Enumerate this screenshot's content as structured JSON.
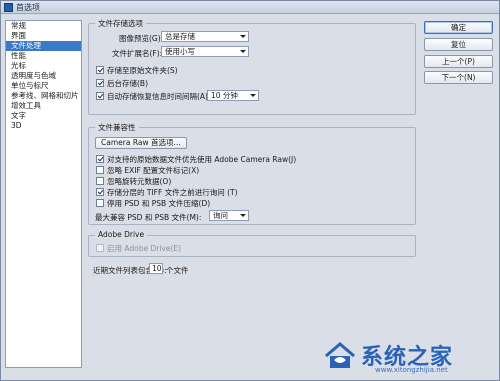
{
  "window": {
    "title": "首选项"
  },
  "sidebar": {
    "items": [
      {
        "label": "常规",
        "selected": false
      },
      {
        "label": "界面",
        "selected": false
      },
      {
        "label": "文件处理",
        "selected": true
      },
      {
        "label": "性能",
        "selected": false
      },
      {
        "label": "光标",
        "selected": false
      },
      {
        "label": "透明度与色域",
        "selected": false
      },
      {
        "label": "单位与标尺",
        "selected": false
      },
      {
        "label": "参考线、网格和切片",
        "selected": false
      },
      {
        "label": "增效工具",
        "selected": false
      },
      {
        "label": "文字",
        "selected": false
      },
      {
        "label": "3D",
        "selected": false
      }
    ]
  },
  "buttons": {
    "ok": "确定",
    "reset": "复位",
    "prev": "上一个(P)",
    "next": "下一个(N)"
  },
  "file_save": {
    "title": "文件存储选项",
    "image_preview_label": "图像预览(G):",
    "image_preview_value": "总是存储",
    "extension_label": "文件扩展名(F):",
    "extension_value": "使用小写",
    "save_as_original": {
      "label": "存储至原始文件夹(S)",
      "checked": true
    },
    "background_save": {
      "label": "后台存储(B)",
      "checked": true
    },
    "auto_save": {
      "label": "自动存储恢复信息时间间隔(A):",
      "checked": true
    },
    "auto_save_interval": "10 分钟"
  },
  "compat": {
    "title": "文件兼容性",
    "camera_raw_button": "Camera Raw 首选项...",
    "options": [
      {
        "label": "对支持的原始数据文件优先使用 Adobe Camera Raw(J)",
        "checked": true
      },
      {
        "label": "忽略 EXIF 配置文件标记(X)",
        "checked": false
      },
      {
        "label": "忽略旋转元数据(O)",
        "checked": false
      },
      {
        "label": "存储分层的 TIFF 文件之前进行询问 (T)",
        "checked": true
      },
      {
        "label": "停用 PSD 和 PSB 文件压缩(D)",
        "checked": false
      }
    ],
    "max_compat_label": "最大兼容 PSD 和 PSB 文件(M):",
    "max_compat_value": "询问"
  },
  "adobe_drive": {
    "title": "Adobe Drive",
    "enable": {
      "label": "启用 Adobe Drive(E)",
      "checked": false,
      "disabled": true
    }
  },
  "recent_files": {
    "label": "近期文件列表包含(R):",
    "value": "10",
    "suffix": "个文件"
  },
  "watermark": {
    "text": "系统之家",
    "url": "www.xitongzhijia.net"
  },
  "colors": {
    "selection": "#3a78c8",
    "watermark": "#2a62b8"
  }
}
